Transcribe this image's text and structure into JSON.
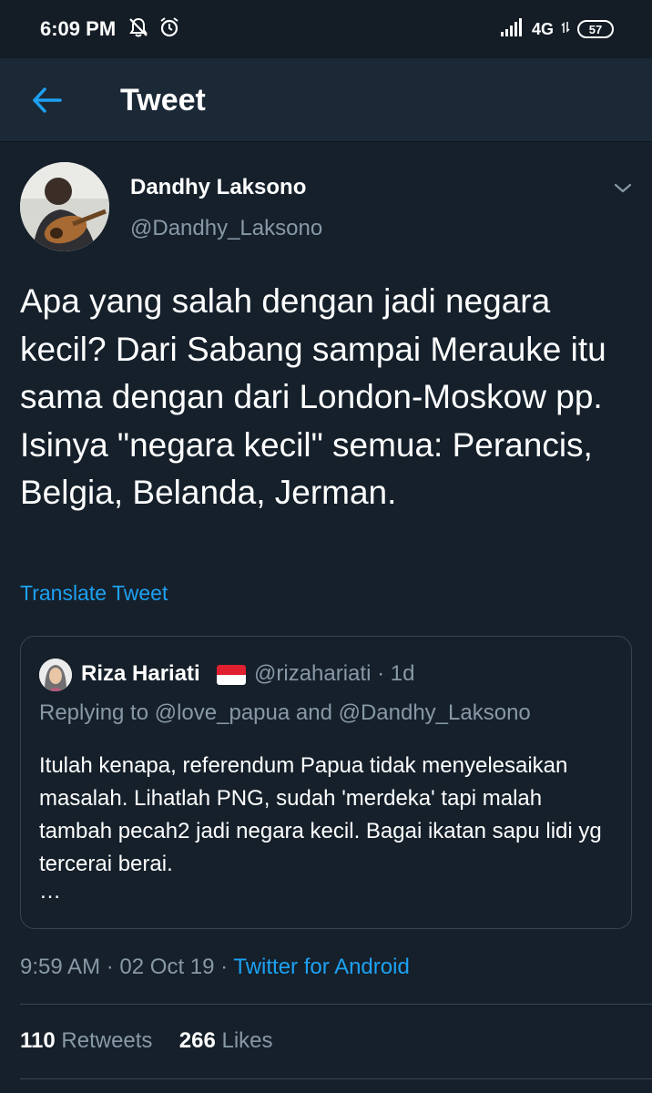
{
  "status_bar": {
    "time": "6:09 PM",
    "network": "4G",
    "battery": "57",
    "icons": [
      "notifications-muted-icon",
      "alarm-icon",
      "signal-icon",
      "battery-icon"
    ]
  },
  "header": {
    "title": "Tweet",
    "back_icon": "arrow-left-icon"
  },
  "tweet": {
    "author_name": "Dandhy Laksono",
    "author_handle": "@Dandhy_Laksono",
    "text": "Apa yang salah dengan jadi negara kecil? Dari Sabang sampai Merauke itu sama dengan dari London-Moskow pp. Isinya \"negara kecil\" semua: Perancis, Belgia, Belanda, Jerman.",
    "translate_label": "Translate Tweet",
    "time": "9:59 AM",
    "date": "02 Oct 19",
    "source": "Twitter for Android",
    "retweets_count": "110",
    "retweets_label": "Retweets",
    "likes_count": "266",
    "likes_label": "Likes"
  },
  "quoted": {
    "name": "Riza Hariati",
    "handle": "@rizahariati",
    "age": "1d",
    "replying": "Replying to @love_papua and @Dandhy_Laksono",
    "text": "Itulah kenapa, referendum Papua tidak menyelesaikan masalah. Lihatlah PNG, sudah 'merdeka' tapi malah tambah pecah2 jadi negara kecil. Bagai ikatan sapu lidi yg tercerai berai.",
    "ellipsis": "…"
  },
  "colors": {
    "background": "#15202b",
    "header": "#1b2836",
    "accent": "#1da1f2",
    "secondary_text": "#8899a6",
    "border": "#38444d"
  }
}
